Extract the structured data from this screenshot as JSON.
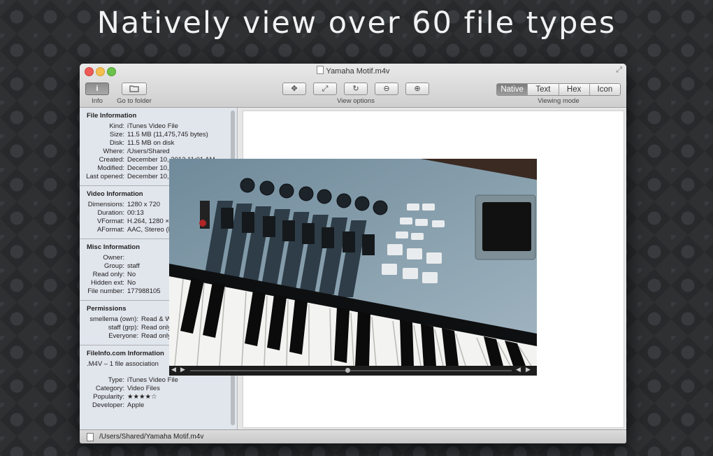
{
  "headline": "Natively view over 60 file types",
  "window": {
    "title": "Yamaha Motif.m4v"
  },
  "toolbar": {
    "info_label": "Info",
    "go_to_folder_label": "Go to folder",
    "view_options_label": "View options",
    "viewing_mode_label": "Viewing mode",
    "modes": [
      "Native",
      "Text",
      "Hex",
      "Icon"
    ],
    "selected_mode": "Native"
  },
  "sidebar": {
    "file_info": {
      "title": "File Information",
      "rows": [
        {
          "k": "Kind:",
          "v": "iTunes Video File"
        },
        {
          "k": "Size:",
          "v": "11.5 MB (11,475,745 bytes)"
        },
        {
          "k": "Disk:",
          "v": "11.5 MB on disk"
        },
        {
          "k": "Where:",
          "v": "/Users/Shared"
        },
        {
          "k": "Created:",
          "v": "December 10, 2012 11:01 AM"
        },
        {
          "k": "Modified:",
          "v": "December 10, 2012 11:01 AM"
        },
        {
          "k": "Last opened:",
          "v": "December 10, 2012 11:06 AM"
        }
      ]
    },
    "video_info": {
      "title": "Video Information",
      "rows": [
        {
          "k": "Dimensions:",
          "v": "1280 x 720"
        },
        {
          "k": "Duration:",
          "v": "00:13"
        },
        {
          "k": "VFormat:",
          "v": "H.264, 1280 × 720,..."
        },
        {
          "k": "AFormat:",
          "v": "AAC, Stereo (L R), 48...."
        }
      ]
    },
    "misc_info": {
      "title": "Misc Information",
      "rows": [
        {
          "k": "Owner:",
          "v": ""
        },
        {
          "k": "Group:",
          "v": "staff"
        },
        {
          "k": "Read only:",
          "v": "No"
        },
        {
          "k": "Hidden ext:",
          "v": "No"
        },
        {
          "k": "File number:",
          "v": "177988105"
        }
      ]
    },
    "permissions": {
      "title": "Permissions",
      "rows": [
        {
          "k": "smellema (own):",
          "v": "Read & Write"
        },
        {
          "k": "staff (grp):",
          "v": "Read only"
        },
        {
          "k": "Everyone:",
          "v": "Read only"
        }
      ]
    },
    "fileinfo": {
      "title": "FileInfo.com Information",
      "association": ".M4V – 1 file association",
      "rows": [
        {
          "k": "Type:",
          "v": "iTunes Video File"
        },
        {
          "k": "Category:",
          "v": "Video Files"
        },
        {
          "k": "Popularity:",
          "v": "★★★★☆"
        },
        {
          "k": "Developer:",
          "v": "Apple"
        }
      ]
    }
  },
  "status": {
    "path": "/Users/Shared/Yamaha Motif.m4v"
  },
  "video": {
    "progress": 0.49
  }
}
